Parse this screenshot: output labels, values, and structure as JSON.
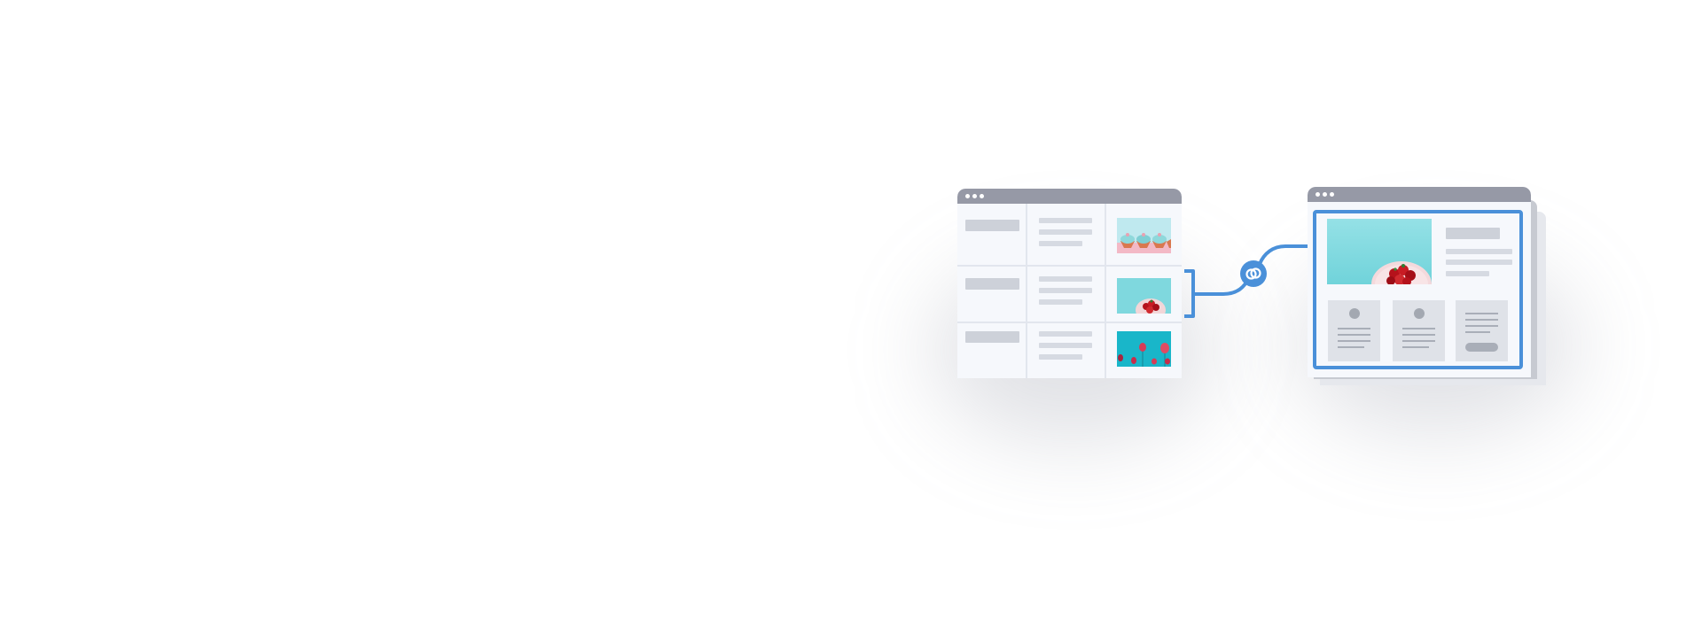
{
  "illustration": {
    "description_free": true,
    "colors": {
      "accent": "#4a90d9",
      "window_bar": "#9699a6",
      "window_bg": "#f6f8fc",
      "placeholder": "#cdd1d9",
      "thumb_sky": "#8fdde3"
    },
    "icons": {
      "link": "link-rings-icon"
    }
  }
}
